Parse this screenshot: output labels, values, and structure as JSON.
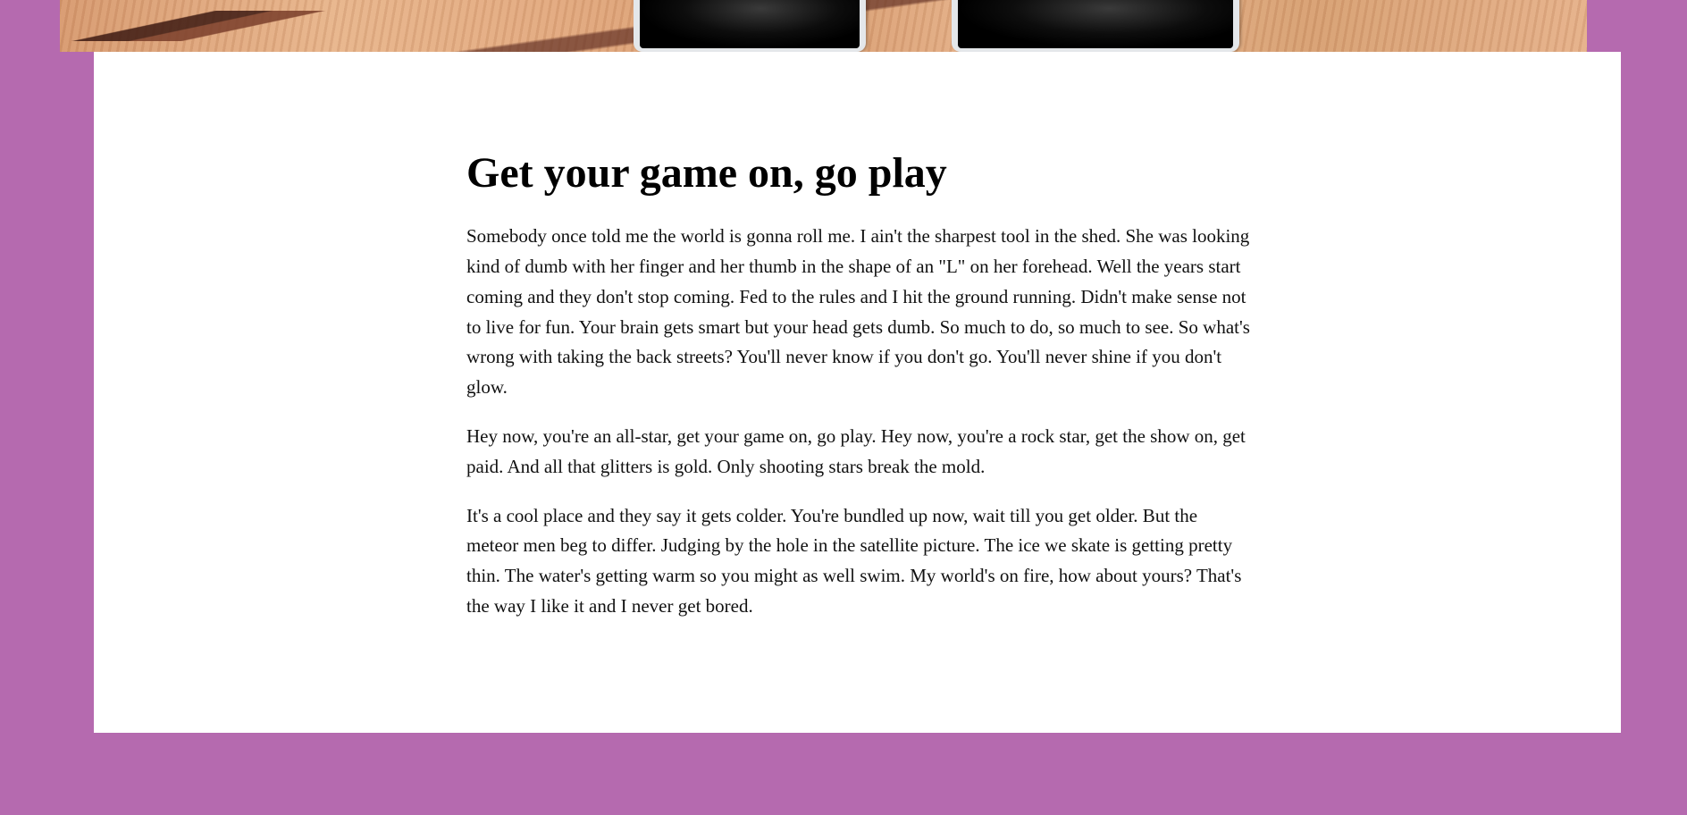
{
  "hero": {
    "image_name": "wood-table-with-phones"
  },
  "article": {
    "title": "Get your game on, go play",
    "paragraphs": [
      "Somebody once told me the world is gonna roll me. I ain't the sharpest tool in the shed. She was looking kind of dumb with her finger and her thumb in the shape of an \"L\" on her forehead. Well the years start coming and they don't stop coming. Fed to the rules and I hit the ground running. Didn't make sense not to live for fun. Your brain gets smart but your head gets dumb. So much to do, so much to see. So what's wrong with taking the back streets? You'll never know if you don't go. You'll never shine if you don't glow.",
      "Hey now, you're an all-star, get your game on, go play. Hey now, you're a rock star, get the show on, get paid. And all that glitters is gold. Only shooting stars break the mold.",
      "It's a cool place and they say it gets colder. You're bundled up now, wait till you get older. But the meteor men beg to differ. Judging by the hole in the satellite picture. The ice we skate is getting pretty thin. The water's getting warm so you might as well swim. My world's on fire, how about yours? That's the way I like it and I never get bored."
    ]
  },
  "colors": {
    "page_background": "#b56aaf",
    "card_background": "#ffffff",
    "text": "#111111"
  }
}
